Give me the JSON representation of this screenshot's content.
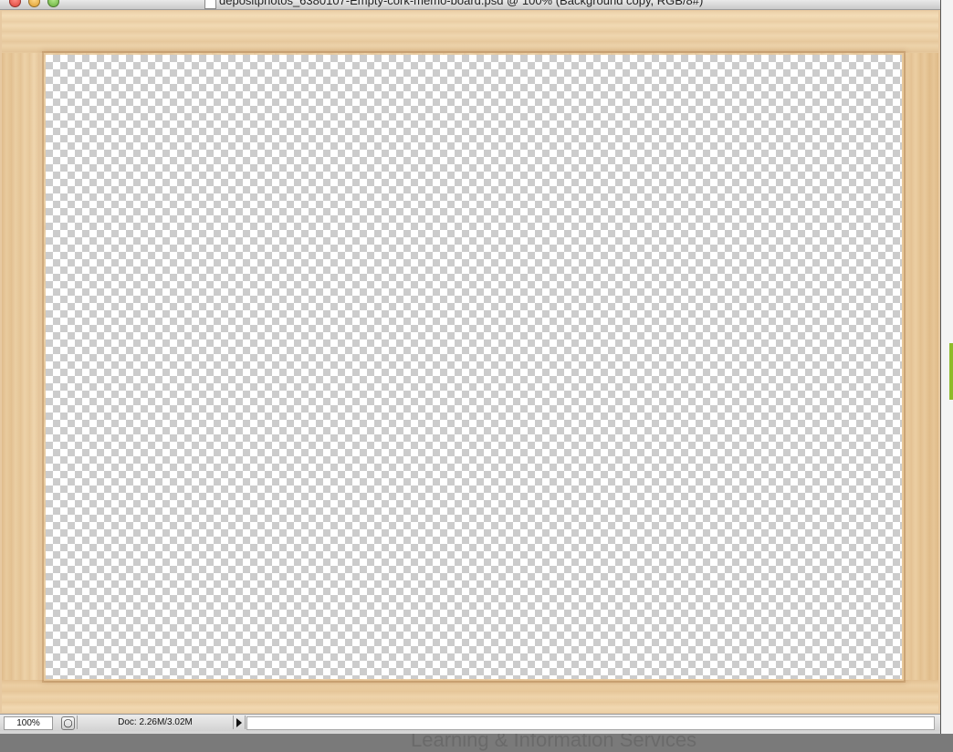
{
  "window": {
    "title": "depositphotos_6380107-Empty-cork-memo-board.psd @ 100% (Background copy, RGB/8#)"
  },
  "statusbar": {
    "zoom": "100%",
    "doc_info": "Doc: 2.26M/3.02M"
  },
  "background_app": {
    "partial_text": "Learning & Information Services"
  },
  "colors": {
    "frame_wood": "#edd3ab",
    "checker_light": "#ffffff",
    "checker_dark": "#cccccc",
    "accent_green": "#8dbb2a"
  },
  "icons": {
    "close": "close-icon",
    "minimize": "minimize-icon",
    "zoom": "zoom-icon",
    "document": "document-icon",
    "status_menu": "status-menu-arrow-icon"
  }
}
